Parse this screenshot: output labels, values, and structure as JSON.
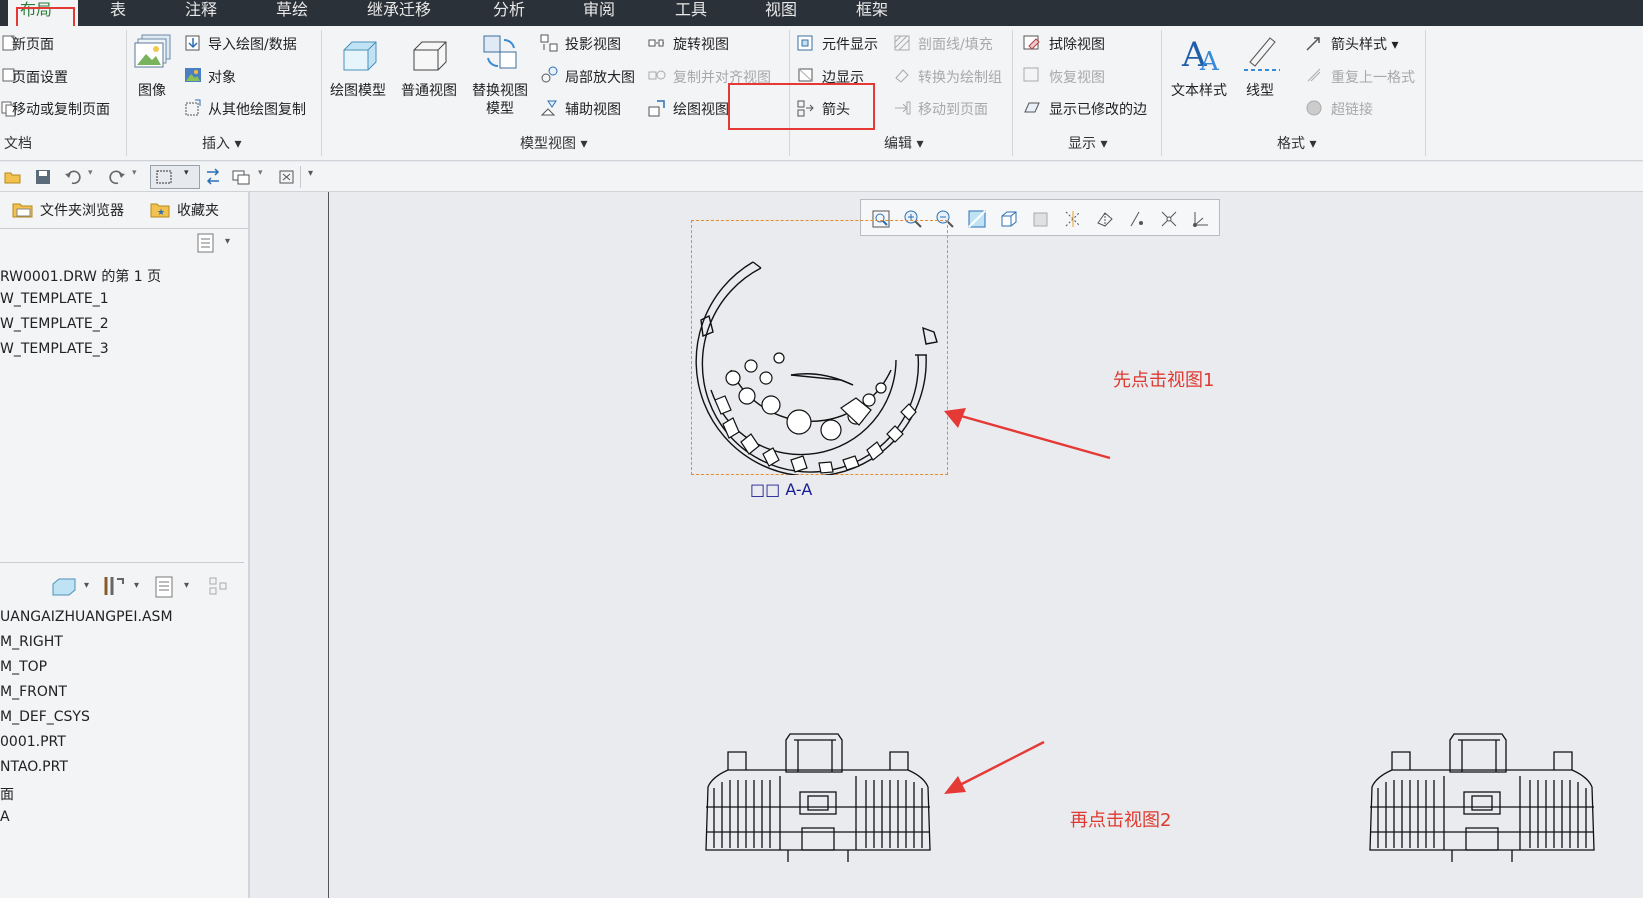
{
  "tabs": [
    {
      "label": "布局",
      "active": true
    },
    {
      "label": "表"
    },
    {
      "label": "注释"
    },
    {
      "label": "草绘"
    },
    {
      "label": "继承迁移"
    },
    {
      "label": "分析"
    },
    {
      "label": "审阅"
    },
    {
      "label": "工具"
    },
    {
      "label": "视图"
    },
    {
      "label": "框架"
    }
  ],
  "ribbon": {
    "document": {
      "group_label": "文档",
      "new_page": "新页面",
      "page_setup": "页面设置",
      "move_copy_page": "移动或复制页面"
    },
    "insert": {
      "group_label": "插入",
      "image": "图像",
      "import_drawing": "导入绘图/数据",
      "object": "对象",
      "copy_from_other": "从其他绘图复制"
    },
    "model_views": {
      "group_label": "模型视图",
      "drawing_model": "绘图模型",
      "general_view": "普通视图",
      "replace_view_model": "替换视图",
      "replace_view_model_2": "模型",
      "projection_view": "投影视图",
      "detail_view": "局部放大图",
      "auxiliary_view": "辅助视图",
      "revolved_view": "旋转视图",
      "copy_align_view": "复制并对齐视图",
      "drawing_view": "绘图视图"
    },
    "edit": {
      "group_label": "编辑",
      "component_display": "元件显示",
      "edge_display": "边显示",
      "arrow": "箭头",
      "hatch_fill": "剖面线/填充",
      "convert_to_group": "转换为绘制组",
      "move_to_page": "移动到页面"
    },
    "display": {
      "group_label": "显示",
      "erase_view": "拭除视图",
      "restore_view": "恢复视图",
      "show_modified_edges": "显示已修改的边"
    },
    "format": {
      "group_label": "格式",
      "text_style": "文本样式",
      "line_style": "线型",
      "arrow_style": "箭头样式",
      "repeat_last_format": "重复上一格式",
      "hyperlink": "超链接"
    }
  },
  "left_panel": {
    "tab_folder_browser": "文件夹浏览器",
    "tab_favorites": "收藏夹",
    "drawing_tree": [
      "RW0001.DRW 的第 1 页",
      "W_TEMPLATE_1",
      "W_TEMPLATE_2",
      "W_TEMPLATE_3"
    ],
    "model_tree": [
      "UANGAIZHUANGPEI.ASM",
      "M_RIGHT",
      "M_TOP",
      "M_FRONT",
      "M_DEF_CSYS",
      "0001.PRT",
      "NTAO.PRT",
      "面",
      "A"
    ]
  },
  "canvas": {
    "view_label": "□□ A-A",
    "annotation_1": "先点击视图1",
    "annotation_2": "再点击视图2"
  },
  "colors": {
    "accent_red": "#e53935",
    "annotation_red": "#e03a30",
    "active_tab_text": "#2d7d3a",
    "tab_bar_bg": "#2b3138",
    "selection_orange": "#e8892a"
  }
}
